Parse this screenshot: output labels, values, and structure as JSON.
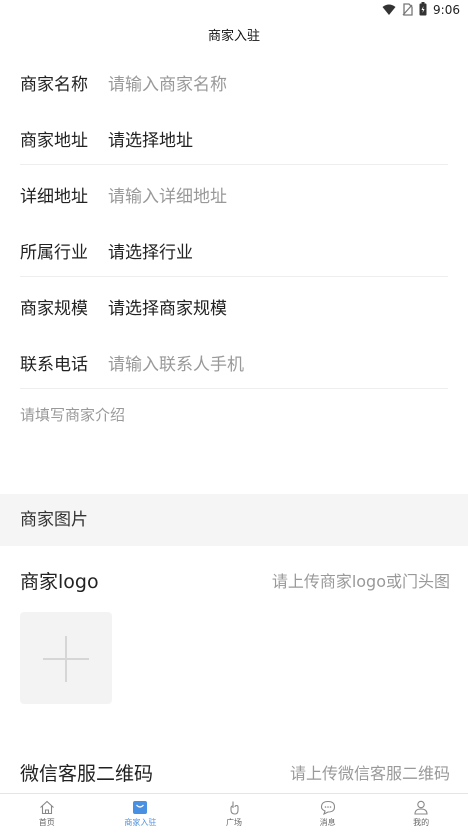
{
  "status_bar": {
    "time": "9:06"
  },
  "header": {
    "title": "商家入驻"
  },
  "form": {
    "name": {
      "label": "商家名称",
      "placeholder": "请输入商家名称"
    },
    "address": {
      "label": "商家地址",
      "value": "请选择地址"
    },
    "detail": {
      "label": "详细地址",
      "placeholder": "请输入详细地址"
    },
    "industry": {
      "label": "所属行业",
      "value": "请选择行业"
    },
    "scale": {
      "label": "商家规模",
      "value": "请选择商家规模"
    },
    "phone": {
      "label": "联系电话",
      "placeholder": "请输入联系人手机"
    },
    "intro_placeholder": "请填写商家介绍"
  },
  "images_section": {
    "title": "商家图片"
  },
  "logo": {
    "label": "商家logo",
    "hint": "请上传商家logo或门头图"
  },
  "wechat": {
    "label": "微信客服二维码",
    "hint": "请上传微信客服二维码"
  },
  "tabs": [
    {
      "label": "首页",
      "icon": "home-icon",
      "active": false
    },
    {
      "label": "商家入驻",
      "icon": "store-icon",
      "active": true
    },
    {
      "label": "广场",
      "icon": "hand-icon",
      "active": false
    },
    {
      "label": "消息",
      "icon": "chat-icon",
      "active": false
    },
    {
      "label": "我的",
      "icon": "user-icon",
      "active": false
    }
  ],
  "colors": {
    "accent": "#4a90e2",
    "placeholder": "#999999",
    "section_bg": "#f5f5f5"
  }
}
